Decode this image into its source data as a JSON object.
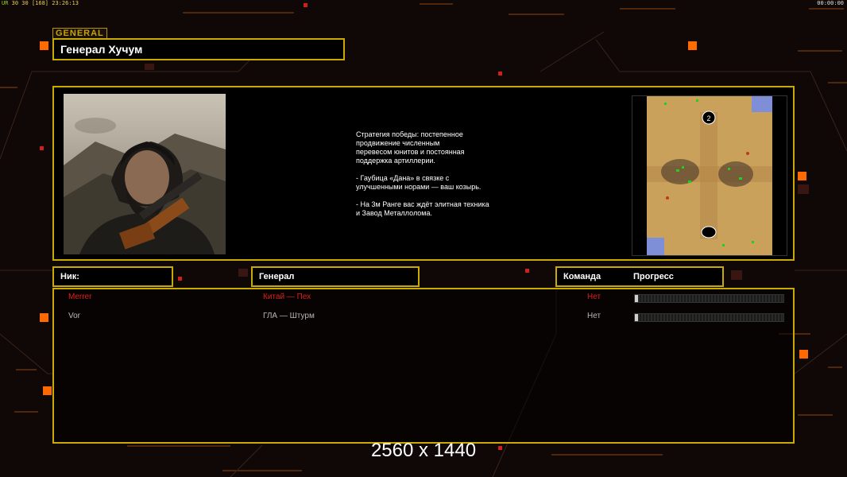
{
  "overlay": {
    "fps_prefix": "UR",
    "fps_values": "30 30",
    "bracket": "[168]",
    "clock": "23:26:13",
    "timer": "00:00:00"
  },
  "header": {
    "tag": "GENERAL",
    "general_name": "Генерал Хучум"
  },
  "briefing": {
    "description": "Стратегия победы: постепенное\nпродвижение численным\nперевесом юнитов и постоянная\nподдержка артиллерии.\n\n- Гаубица «Дана» в связке с\nулучшенными норами — ваш козырь.\n\n- На 3м Ранге вас ждёт элитная техника\nи Завод Металлолома."
  },
  "minimap": {
    "slot_top": "2"
  },
  "columns": {
    "nick": "Ник:",
    "general": "Генерал",
    "team": "Команда",
    "progress": "Прогресс"
  },
  "players": [
    {
      "nick": "Merrer",
      "general": "Китай — Пех",
      "team": "Нет",
      "progress": 0.01,
      "color": "#e0201a"
    },
    {
      "nick": "Vor",
      "general": "ГЛА — Штурм",
      "team": "Нет",
      "progress": 0.01,
      "color": "#b8b8b8"
    }
  ],
  "resolution": "2560 x 1440",
  "colors": {
    "accent": "#c8aa00",
    "orange": "#ff6a00",
    "background": "#0f0806"
  }
}
